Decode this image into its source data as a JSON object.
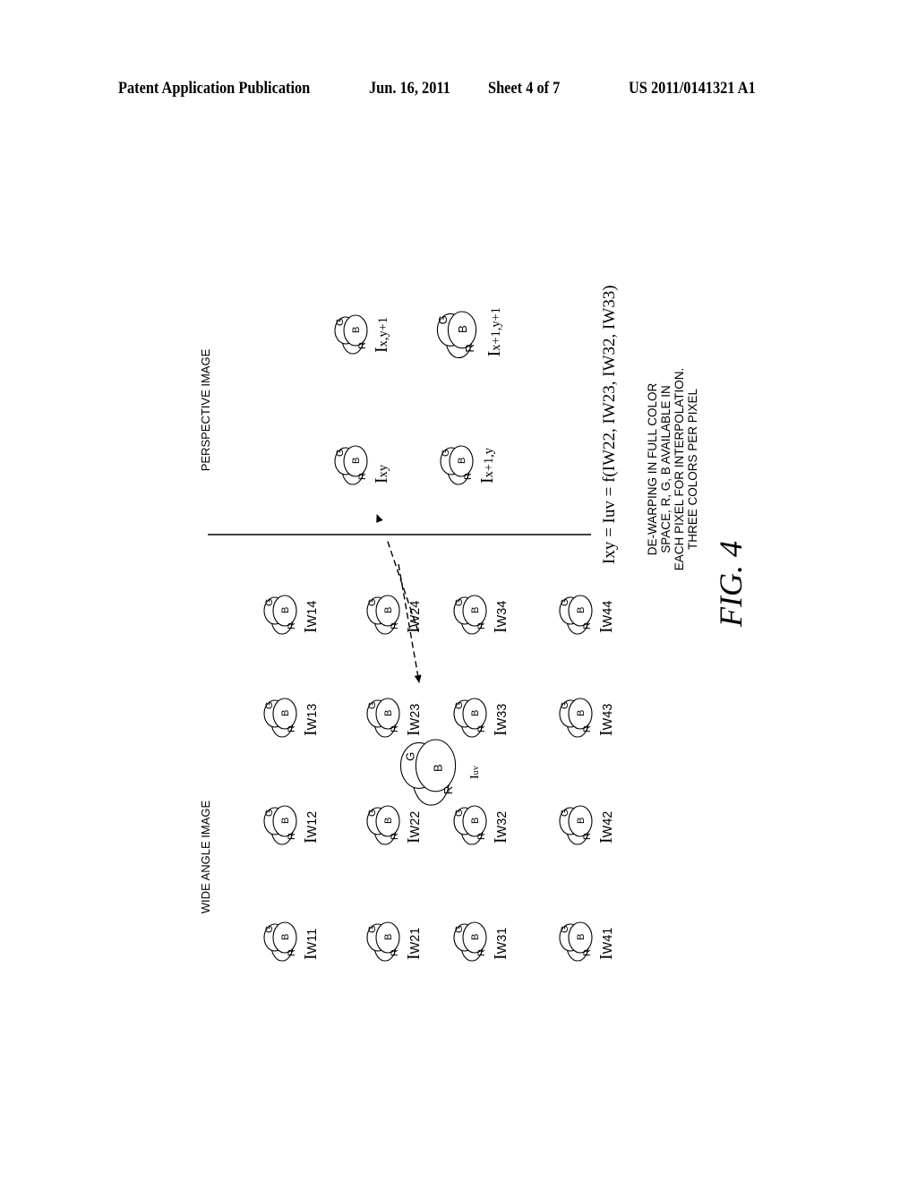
{
  "header": {
    "publication": "Patent Application Publication",
    "date_sheet": "Jun. 16, 2011",
    "sheet": "Sheet 4 of 7",
    "number": "US 2011/0141321 A1"
  },
  "figure": {
    "caption": "FIG. 4",
    "wide_label": "WIDE ANGLE IMAGE",
    "perspective_label": "PERSPECTIVE IMAGE",
    "pixel_channels": {
      "r": "R",
      "g": "G",
      "b": "B"
    },
    "wide_pixels": [
      [
        "IW11",
        "IW12",
        "IW13",
        "IW14"
      ],
      [
        "IW21",
        "IW22",
        "IW23",
        "IW24"
      ],
      [
        "IW31",
        "IW32",
        "IW33",
        "IW34"
      ],
      [
        "IW41",
        "IW42",
        "IW43",
        "IW44"
      ]
    ],
    "interp_pixel": "Iuv",
    "perspective_pixels": [
      [
        "Ixy",
        "Ix,y+1"
      ],
      [
        "Ix+1,y",
        "Ix+1,y+1"
      ]
    ],
    "equation": "Ixy = Iuv = f(IW22, IW23, IW32, IW33)",
    "note_lines": [
      "DE-WARPING IN FULL COLOR",
      "SPACE, R, G, B AVAILABLE IN",
      "EACH PIXEL FOR INTERPOLATION.",
      "THREE COLORS PER PIXEL"
    ]
  }
}
